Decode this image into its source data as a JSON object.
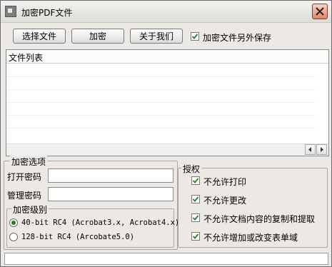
{
  "window": {
    "title": "加密PDF文件"
  },
  "toolbar": {
    "select_file": "选择文件",
    "encrypt": "加密",
    "about": "关于我们",
    "save_separately": {
      "label": "加密文件另外保存",
      "checked": true
    }
  },
  "file_list": {
    "header": "文件列表",
    "files": []
  },
  "encrypt_options": {
    "legend": "加密选项",
    "open_password_label": "打开密码",
    "open_password_value": "",
    "admin_password_label": "管理密码",
    "admin_password_value": "",
    "level": {
      "legend": "加密级别",
      "options": [
        {
          "label": "40-bit RC4 (Acrobat3.x, Acrobat4.x)",
          "selected": true
        },
        {
          "label": "128-bit RC4 (Arcobate5.0)",
          "selected": false
        }
      ]
    }
  },
  "permissions": {
    "legend": "授权",
    "items": [
      {
        "label": "不允许打印",
        "checked": true
      },
      {
        "label": "不允许更改",
        "checked": true
      },
      {
        "label": "不允许文档内容的复制和提取",
        "checked": true
      },
      {
        "label": "不允许增加或改变表单域",
        "checked": true
      }
    ]
  },
  "status": {
    "text": ""
  },
  "colors": {
    "check": "#2b7a2b",
    "close": "#c8553a"
  }
}
